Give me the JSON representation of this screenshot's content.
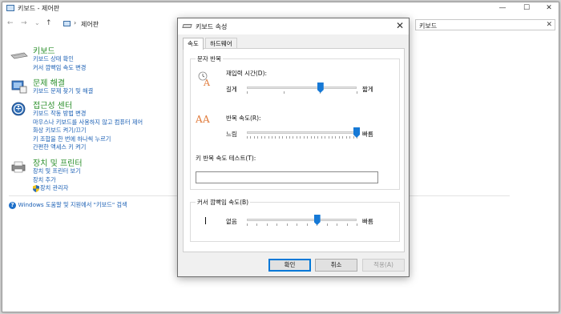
{
  "window": {
    "title": "키보드 - 제어판",
    "controls": {
      "minimize": "—",
      "maximize": "☐",
      "close": "✕"
    }
  },
  "nav": {
    "back": "←",
    "forward": "→",
    "history": "⌄",
    "up": "↑",
    "breadcrumb_separator": "›",
    "breadcrumb": "제어판",
    "search_value": "키보드",
    "search_icon": "✕"
  },
  "categories": [
    {
      "title": "키보드",
      "icon": "keyboard-icon",
      "links": [
        "키보드 상태 확인",
        "커서 깜빡임 속도 변경"
      ]
    },
    {
      "title": "문제 해결",
      "icon": "troubleshoot-icon",
      "links": [
        "키보드 문제 찾기 및 해결"
      ]
    },
    {
      "title": "접근성 센터",
      "icon": "accessibility-icon",
      "links": [
        "키보드 작동 방법 변경",
        "마우스나 키보드를 사용하지 않고 컴퓨터 제어",
        "화상 키보드 켜기/끄기",
        "키 조합을 한 번에 하나씩 누르기",
        "간편한 액세스 키 켜기"
      ]
    },
    {
      "title": "장치 및 프린터",
      "icon": "printer-icon",
      "links": [
        "장치 및 프린터 보기",
        "장치 추가",
        "장치 관리자"
      ]
    }
  ],
  "help_text": "Windows 도움말 및 지원에서 \"키보드\" 검색",
  "help_icon": "?",
  "dialog": {
    "title": "키보드 속성",
    "close": "✕",
    "tabs": [
      "속도",
      "하드웨어"
    ],
    "active_tab": 0,
    "repeat_group": {
      "label": "문자 반복",
      "delay_label": "재입력 시간(D):",
      "delay_min": "길게",
      "delay_max": "짧게",
      "delay_value": 0.67,
      "rate_label": "반복 속도(R):",
      "rate_min": "느림",
      "rate_max": "빠름",
      "rate_value": 1.0,
      "test_label": "키 반복 속도 테스트(T):",
      "test_value": ""
    },
    "cursor_group": {
      "label": "커서 깜빡임 속도(B)",
      "min": "없음",
      "max": "빠름",
      "value": 0.64
    },
    "buttons": {
      "ok": "확인",
      "cancel": "취소",
      "apply": "적용(A)"
    }
  }
}
